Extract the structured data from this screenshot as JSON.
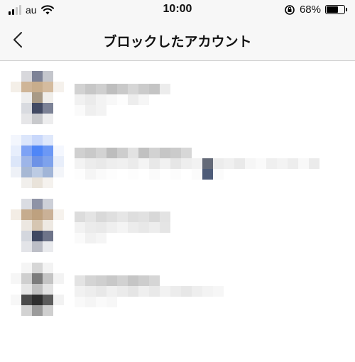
{
  "status_bar": {
    "carrier": "au",
    "time": "10:00",
    "battery_percent": "68%",
    "battery_level": 0.68,
    "icons": [
      "signal-icon",
      "wifi-icon",
      "orientation-lock-icon",
      "battery-icon"
    ]
  },
  "nav": {
    "title": "ブロックしたアカウント",
    "back_icon": "chevron-left-icon"
  },
  "blocked_accounts": [
    {
      "avatar": "pixelated",
      "username": "obscured",
      "display_name": "obscured"
    },
    {
      "avatar": "pixelated",
      "username": "obscured",
      "display_name": "obscured"
    },
    {
      "avatar": "pixelated",
      "username": "obscured",
      "display_name": "obscured"
    },
    {
      "avatar": "pixelated",
      "username": "obscured",
      "display_name": "obscured"
    }
  ]
}
